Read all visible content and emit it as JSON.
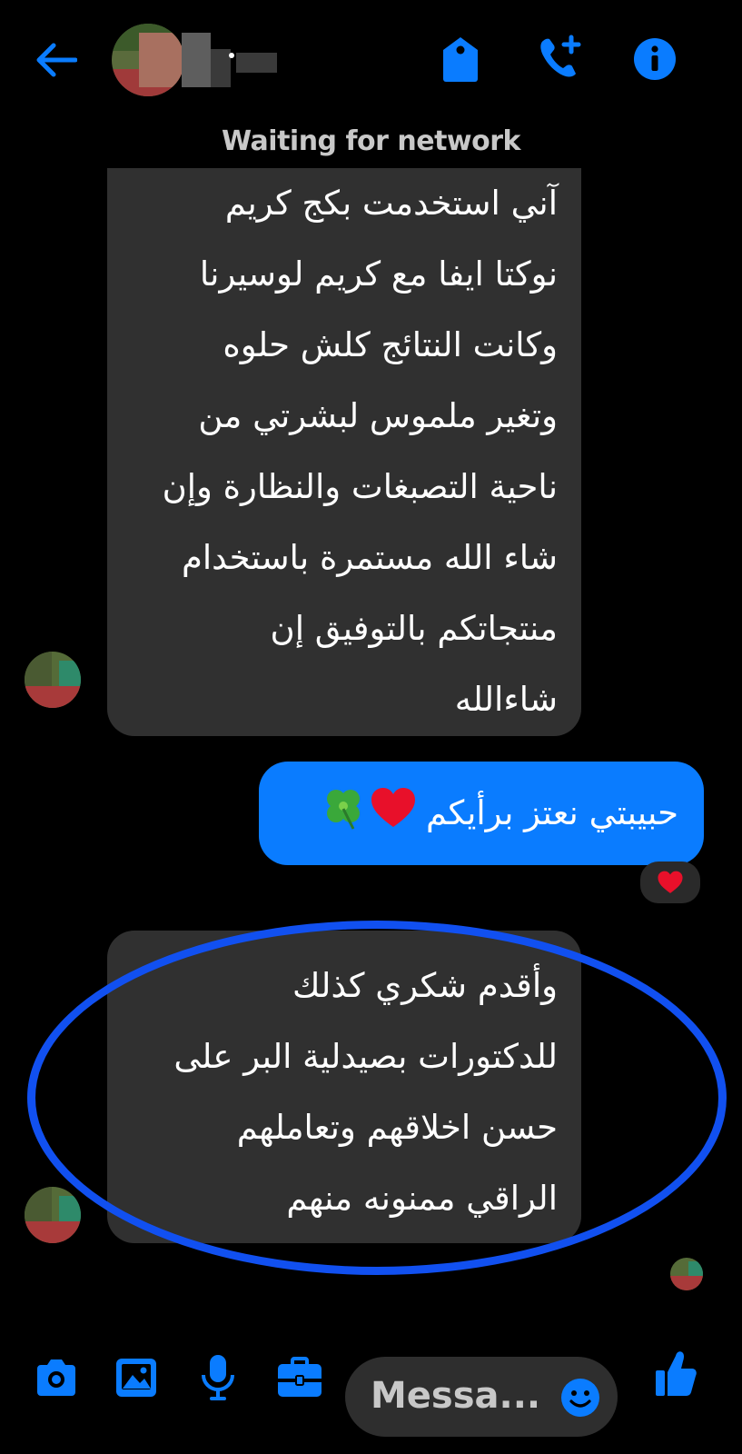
{
  "header": {
    "back_icon": "arrow-left-icon",
    "contact_name": "",
    "actions": [
      {
        "name": "tag-icon"
      },
      {
        "name": "phone-add-icon"
      },
      {
        "name": "info-icon"
      }
    ],
    "accent_color": "#0a7cff"
  },
  "status": {
    "text": "Waiting for network"
  },
  "messages": [
    {
      "direction": "incoming",
      "lines": [
        "آني استخدمت بكج كريم",
        "نوكتا ايفا مع كريم لوسيرنا",
        "وكانت النتائج كلش حلوه",
        "وتغير ملموس لبشرتي من",
        "ناحية التصبغات والنظارة وإن",
        "شاء الله مستمرة باستخدام",
        "منتجاتكم بالتوفيق إن",
        "شاءالله"
      ]
    },
    {
      "direction": "outgoing",
      "text": "حبيبتي نعتز برأيكم",
      "reaction": "heart"
    },
    {
      "direction": "incoming",
      "highlighted": true,
      "lines": [
        "وأقدم شكري كذلك",
        "للدكتورات بصيدلية البر على",
        "حسن اخلاقهم وتعاملهم",
        "الراقي ممنونه منهم"
      ]
    }
  ],
  "composer": {
    "placeholder": "Messa...",
    "tools": [
      "camera-icon",
      "image-icon",
      "microphone-icon",
      "briefcase-icon"
    ],
    "emoji_icon": "emoji-icon",
    "send_icon": "thumbs-up-icon"
  }
}
